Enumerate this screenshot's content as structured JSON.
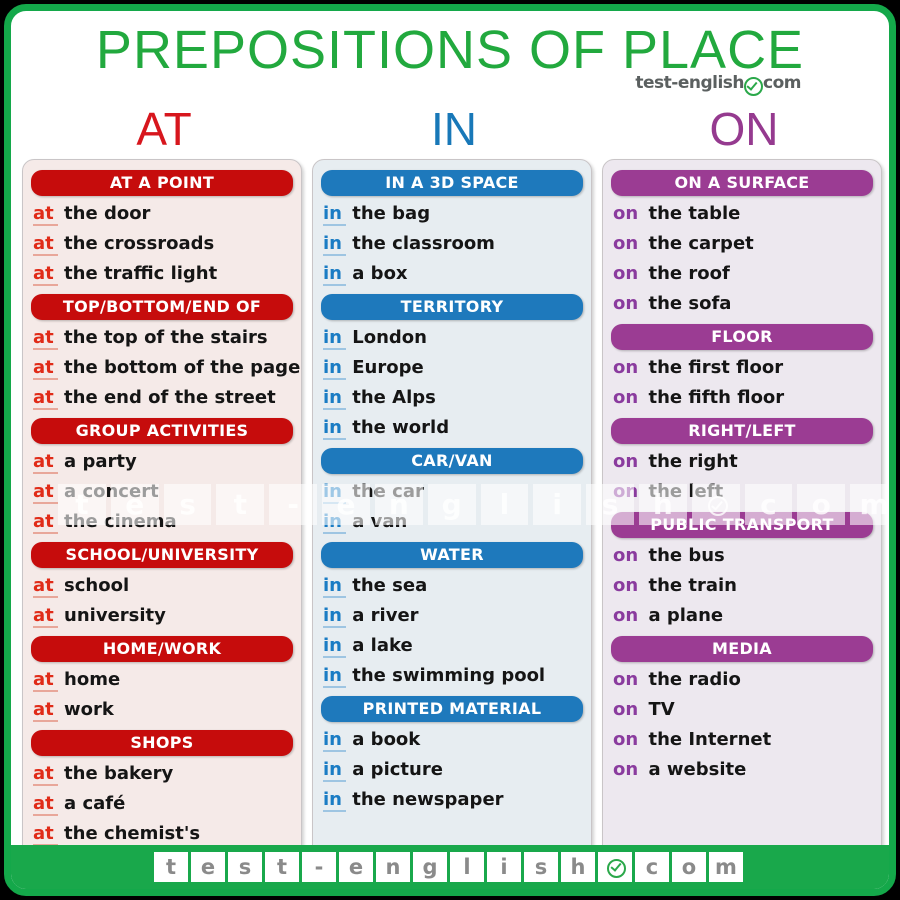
{
  "header": {
    "title": "PREPOSITIONS OF PLACE",
    "logo_left": "test-english",
    "logo_badge": "check-circle-icon",
    "logo_right": "com",
    "title_color": "#22A93E"
  },
  "columns": [
    {
      "id": "at",
      "label": "AT",
      "label_color": "#D7161D",
      "pill_color": "#C60C0C",
      "panel_color": "#F5EAE8",
      "preposition": "at",
      "groups": [
        {
          "heading": "AT A POINT",
          "items": [
            "the door",
            "the crossroads",
            "the traffic light"
          ]
        },
        {
          "heading": "TOP/BOTTOM/END OF",
          "items": [
            "the top  of the stairs",
            "the bottom of the page",
            "the end of the street"
          ]
        },
        {
          "heading": "GROUP ACTIVITIES",
          "items": [
            "a party",
            "a concert",
            "the cinema"
          ]
        },
        {
          "heading": "SCHOOL/UNIVERSITY",
          "items": [
            "school",
            "university"
          ]
        },
        {
          "heading": "HOME/WORK",
          "items": [
            "home",
            "work"
          ]
        },
        {
          "heading": "SHOPS",
          "items": [
            "the bakery",
            "a café",
            "the chemist's"
          ]
        }
      ]
    },
    {
      "id": "in",
      "label": "IN",
      "label_color": "#1878B8",
      "pill_color": "#1E79BC",
      "panel_color": "#E7EDF1",
      "preposition": "in",
      "groups": [
        {
          "heading": "IN A 3D SPACE",
          "items": [
            "the bag",
            "the classroom",
            "a box"
          ]
        },
        {
          "heading": "TERRITORY",
          "items": [
            "London",
            "Europe",
            "the Alps",
            "the world"
          ]
        },
        {
          "heading": "CAR/VAN",
          "items": [
            "the car",
            "a van"
          ]
        },
        {
          "heading": "WATER",
          "items": [
            "the sea",
            "a river",
            "a lake",
            "the swimming pool"
          ]
        },
        {
          "heading": "PRINTED MATERIAL",
          "items": [
            "a book",
            "a picture",
            "the newspaper"
          ]
        }
      ]
    },
    {
      "id": "on",
      "label": "ON",
      "label_color": "#953A8F",
      "pill_color": "#9B3C93",
      "panel_color": "#EDE8EF",
      "preposition": "on",
      "groups": [
        {
          "heading": "ON A SURFACE",
          "items": [
            "the table",
            "the carpet",
            "the roof",
            "the sofa"
          ]
        },
        {
          "heading": "FLOOR",
          "items": [
            "the first floor",
            "the fifth floor"
          ]
        },
        {
          "heading": "RIGHT/LEFT",
          "items": [
            "the right",
            "the left"
          ]
        },
        {
          "heading": "PUBLIC TRANSPORT",
          "items": [
            "the bus",
            "the train",
            "a plane"
          ]
        },
        {
          "heading": "MEDIA",
          "items": [
            "the radio",
            "TV",
            "the Internet",
            "a website"
          ]
        }
      ]
    }
  ],
  "watermark": {
    "tiles": [
      "t",
      "e",
      "s",
      "t",
      "-",
      "e",
      "n",
      "g",
      "l",
      "i",
      "s",
      "h",
      "badge",
      "c",
      "o",
      "m"
    ]
  },
  "footer": {
    "background": "#19A84B",
    "tiles": [
      "t",
      "e",
      "s",
      "t",
      "-",
      "e",
      "n",
      "g",
      "l",
      "i",
      "s",
      "h",
      "badge",
      "c",
      "o",
      "m"
    ]
  }
}
